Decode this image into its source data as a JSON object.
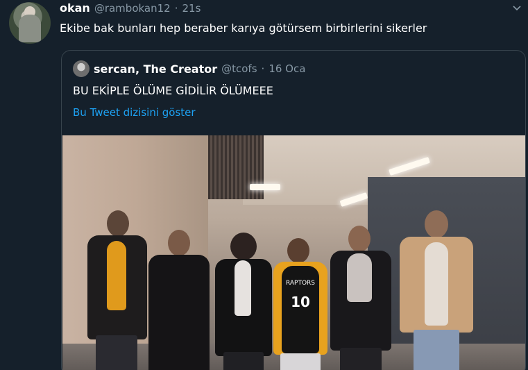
{
  "tweet": {
    "display_name": "okan",
    "handle": "@rambokan12",
    "separator": "·",
    "time": "21s",
    "text": "Ekibe bak bunları hep beraber karıya götürsem birbirlerini sikerler",
    "menu_icon": "chevron-down-icon"
  },
  "quoted_tweet": {
    "display_name": "sercan, The Creator",
    "handle": "@tcofs",
    "separator": "·",
    "time": "16 Oca",
    "text": "BU EKİPLE ÖLÜME GİDİLİR ÖLÜMEEE",
    "thread_link": "Bu Tweet dizisini göster",
    "link_color": "#1da1f2"
  },
  "photo": {
    "jersey_text": "RAPTORS",
    "jersey_number": "10"
  },
  "colors": {
    "background": "#15202b",
    "secondary_text": "#8899a6",
    "border": "#38444d"
  }
}
